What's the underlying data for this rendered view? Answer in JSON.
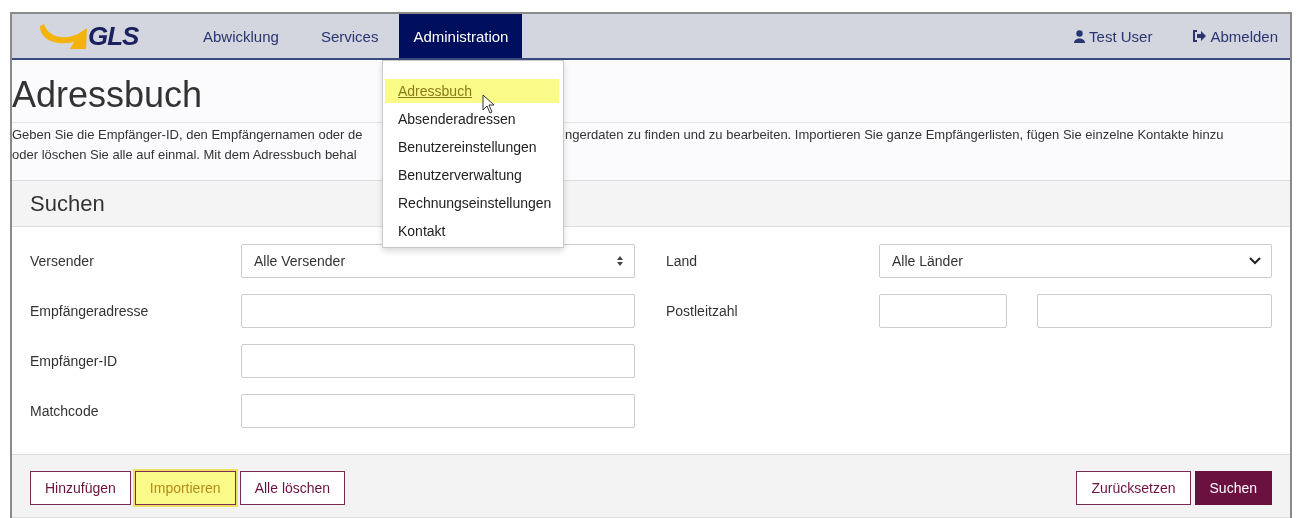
{
  "nav": {
    "logo": "GLS",
    "items": [
      {
        "label": "Abwicklung",
        "selected": false
      },
      {
        "label": "Services",
        "selected": false
      },
      {
        "label": "Administration",
        "selected": true
      }
    ],
    "user": "Test User",
    "logout": "Abmelden"
  },
  "menu": {
    "items": [
      {
        "label": "Adressbuch",
        "highlighted": true
      },
      {
        "label": "Absenderadressen",
        "highlighted": false
      },
      {
        "label": "Benutzereinstellungen",
        "highlighted": false
      },
      {
        "label": "Benutzerverwaltung",
        "highlighted": false
      },
      {
        "label": "Rechnungseinstellungen",
        "highlighted": false
      },
      {
        "label": "Kontakt",
        "highlighted": false
      }
    ]
  },
  "page": {
    "title": "Adressbuch",
    "intro": [
      [
        "Geben Sie die Empfänger-ID, den Empfängernamen oder de",
        "ngerdaten zu finden und zu bearbeiten. Importieren Sie ganze Empfängerlisten, fügen Sie einzelne Kontakte hinzu"
      ],
      [
        "oder löschen Sie alle auf einmal. Mit dem Adressbuch behal"
      ]
    ]
  },
  "search": {
    "title": "Suchen",
    "left_fields": [
      {
        "label": "Versender",
        "kind": "select",
        "value": "Alle Versender"
      },
      {
        "label": "Empfängeradresse",
        "kind": "text"
      },
      {
        "label": "Empfänger-ID",
        "kind": "text"
      },
      {
        "label": "Matchcode",
        "kind": "text"
      }
    ],
    "right_fields": [
      {
        "label": "Land",
        "kind": "dropdown",
        "value": "Alle Länder"
      },
      {
        "label": "Postleitzahl",
        "kind": "range"
      }
    ],
    "buttons_left": [
      {
        "label": "Hinzufügen",
        "highlighted": false
      },
      {
        "label": "Importieren",
        "highlighted": true
      },
      {
        "label": "Alle löschen",
        "highlighted": false
      }
    ],
    "buttons_right": [
      {
        "label": "Zurücksetzen",
        "primary": false
      },
      {
        "label": "Suchen",
        "primary": true
      }
    ]
  }
}
